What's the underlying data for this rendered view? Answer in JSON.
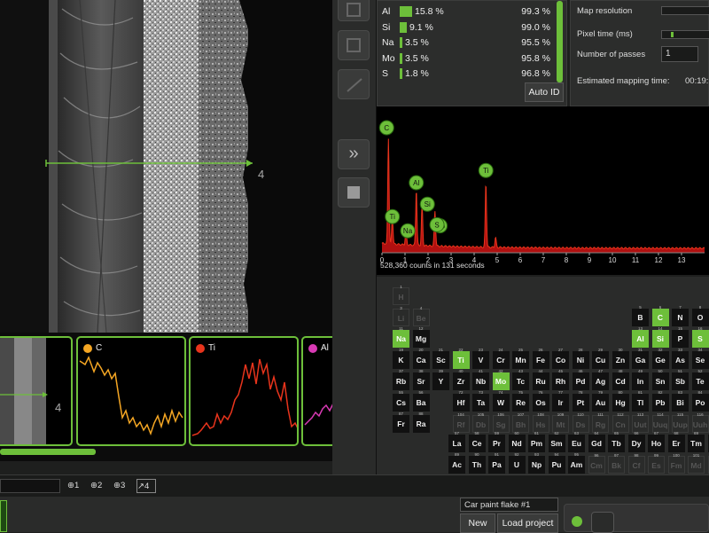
{
  "sem": {
    "line_label": "4"
  },
  "strip": {
    "thumb_label": "4",
    "channels": [
      {
        "name": "C",
        "color": "#f5a623"
      },
      {
        "name": "Ti",
        "color": "#e8341c"
      },
      {
        "name": "Al",
        "color": "#d83ab4"
      }
    ],
    "progress": 1.0
  },
  "elements": [
    {
      "sym": "Al",
      "pct": "15.8 %",
      "frac": 0.158,
      "conf": "99.3 %"
    },
    {
      "sym": "Si",
      "pct": "9.1 %",
      "frac": 0.091,
      "conf": "99.0 %"
    },
    {
      "sym": "Na",
      "pct": "3.5 %",
      "frac": 0.035,
      "conf": "95.5 %"
    },
    {
      "sym": "Mo",
      "pct": "3.5 %",
      "frac": 0.035,
      "conf": "95.8 %"
    },
    {
      "sym": "S",
      "pct": "1.8 %",
      "frac": 0.018,
      "conf": "96.8 %"
    }
  ],
  "auto_id_label": "Auto ID",
  "map_settings": {
    "resolution_label": "Map resolution",
    "pixel_time_label": "Pixel time (ms)",
    "passes_label": "Number of passes",
    "passes_value": "1",
    "est_time_label": "Estimated mapping time:",
    "est_time_value": "00:19:"
  },
  "chart_data": {
    "type": "line",
    "caption": "528,360 counts in 131 seconds",
    "xlim": [
      0,
      14
    ],
    "xticks": [
      "0",
      "1",
      "2",
      "3",
      "4",
      "5",
      "6",
      "7",
      "8",
      "9",
      "10",
      "11",
      "12",
      "13"
    ],
    "peaks": [
      {
        "label": "C",
        "x": 0.28,
        "y": 0.85
      },
      {
        "label": "Ti",
        "x": 0.45,
        "y": 0.22
      },
      {
        "label": "Na",
        "x": 1.04,
        "y": 0.12
      },
      {
        "label": "Al",
        "x": 1.49,
        "y": 0.45
      },
      {
        "label": "Si",
        "x": 1.74,
        "y": 0.32
      },
      {
        "label": "Mo",
        "x": 2.29,
        "y": 0.16
      },
      {
        "label": "S",
        "x": 2.31,
        "y": 0.14
      },
      {
        "label": "Ti",
        "x": 4.51,
        "y": 0.52
      },
      {
        "label": "Ti",
        "x": 4.93,
        "y": 0.08
      }
    ]
  },
  "periodic": {
    "rows": [
      [
        [
          "1",
          "H",
          1,
          "dim"
        ]
      ],
      [
        [
          "3",
          "Li",
          1,
          "dim"
        ],
        [
          "4",
          "Be",
          2,
          "dim"
        ],
        [
          "5",
          "B",
          13,
          ""
        ],
        [
          "6",
          "C",
          14,
          "sel"
        ],
        [
          "7",
          "N",
          15,
          ""
        ],
        [
          "8",
          "O",
          16,
          ""
        ]
      ],
      [
        [
          "11",
          "Na",
          1,
          "sel"
        ],
        [
          "12",
          "Mg",
          2,
          ""
        ],
        [
          "13",
          "Al",
          13,
          "sel"
        ],
        [
          "14",
          "Si",
          14,
          "sel"
        ],
        [
          "15",
          "P",
          15,
          ""
        ],
        [
          "16",
          "S",
          16,
          "sel"
        ]
      ],
      [
        [
          "19",
          "K",
          1,
          ""
        ],
        [
          "20",
          "Ca",
          2,
          ""
        ],
        [
          "21",
          "Sc",
          3,
          ""
        ],
        [
          "22",
          "Ti",
          4,
          "sel"
        ],
        [
          "23",
          "V",
          5,
          ""
        ],
        [
          "24",
          "Cr",
          6,
          ""
        ],
        [
          "25",
          "Mn",
          7,
          ""
        ],
        [
          "26",
          "Fe",
          8,
          ""
        ],
        [
          "27",
          "Co",
          9,
          ""
        ],
        [
          "28",
          "Ni",
          10,
          ""
        ],
        [
          "29",
          "Cu",
          11,
          ""
        ],
        [
          "30",
          "Zn",
          12,
          ""
        ],
        [
          "31",
          "Ga",
          13,
          ""
        ],
        [
          "32",
          "Ge",
          14,
          ""
        ],
        [
          "33",
          "As",
          15,
          ""
        ],
        [
          "34",
          "Se",
          16,
          ""
        ]
      ],
      [
        [
          "37",
          "Rb",
          1,
          ""
        ],
        [
          "38",
          "Sr",
          2,
          ""
        ],
        [
          "39",
          "Y",
          3,
          ""
        ],
        [
          "40",
          "Zr",
          4,
          ""
        ],
        [
          "41",
          "Nb",
          5,
          ""
        ],
        [
          "42",
          "Mo",
          6,
          "sel"
        ],
        [
          "43",
          "Tc",
          7,
          ""
        ],
        [
          "44",
          "Ru",
          8,
          ""
        ],
        [
          "45",
          "Rh",
          9,
          ""
        ],
        [
          "46",
          "Pd",
          10,
          ""
        ],
        [
          "47",
          "Ag",
          11,
          ""
        ],
        [
          "48",
          "Cd",
          12,
          ""
        ],
        [
          "49",
          "In",
          13,
          ""
        ],
        [
          "50",
          "Sn",
          14,
          ""
        ],
        [
          "51",
          "Sb",
          15,
          ""
        ],
        [
          "52",
          "Te",
          16,
          ""
        ]
      ],
      [
        [
          "55",
          "Cs",
          1,
          ""
        ],
        [
          "56",
          "Ba",
          2,
          ""
        ],
        [
          "72",
          "Hf",
          4,
          ""
        ],
        [
          "73",
          "Ta",
          5,
          ""
        ],
        [
          "74",
          "W",
          6,
          ""
        ],
        [
          "75",
          "Re",
          7,
          ""
        ],
        [
          "76",
          "Os",
          8,
          ""
        ],
        [
          "77",
          "Ir",
          9,
          ""
        ],
        [
          "78",
          "Pt",
          10,
          ""
        ],
        [
          "79",
          "Au",
          11,
          ""
        ],
        [
          "80",
          "Hg",
          12,
          ""
        ],
        [
          "81",
          "Tl",
          13,
          ""
        ],
        [
          "82",
          "Pb",
          14,
          ""
        ],
        [
          "83",
          "Bi",
          15,
          ""
        ],
        [
          "84",
          "Po",
          16,
          ""
        ]
      ],
      [
        [
          "87",
          "Fr",
          1,
          ""
        ],
        [
          "88",
          "Ra",
          2,
          ""
        ],
        [
          "104",
          "Rf",
          4,
          "dim"
        ],
        [
          "105",
          "Db",
          5,
          "dim"
        ],
        [
          "106",
          "Sg",
          6,
          "dim"
        ],
        [
          "107",
          "Bh",
          7,
          "dim"
        ],
        [
          "108",
          "Hs",
          8,
          "dim"
        ],
        [
          "109",
          "Mt",
          9,
          "dim"
        ],
        [
          "110",
          "Ds",
          10,
          "dim"
        ],
        [
          "111",
          "Rg",
          11,
          "dim"
        ],
        [
          "112",
          "Cn",
          12,
          "dim"
        ],
        [
          "113",
          "Uut",
          13,
          "dim"
        ],
        [
          "114",
          "Uuq",
          14,
          "dim"
        ],
        [
          "115",
          "Uup",
          15,
          "dim"
        ],
        [
          "116",
          "Uuh",
          16,
          "dim"
        ]
      ]
    ],
    "lanthanides": [
      [
        "57",
        "La"
      ],
      [
        "58",
        "Ce"
      ],
      [
        "59",
        "Pr"
      ],
      [
        "60",
        "Nd"
      ],
      [
        "61",
        "Pm"
      ],
      [
        "62",
        "Sm"
      ],
      [
        "63",
        "Eu"
      ],
      [
        "64",
        "Gd"
      ],
      [
        "65",
        "Tb"
      ],
      [
        "66",
        "Dy"
      ],
      [
        "67",
        "Ho"
      ],
      [
        "68",
        "Er"
      ],
      [
        "69",
        "Tm"
      ],
      [
        "70",
        "Yb"
      ]
    ],
    "actinides": [
      [
        "89",
        "Ac"
      ],
      [
        "90",
        "Th"
      ],
      [
        "91",
        "Pa"
      ],
      [
        "92",
        "U"
      ],
      [
        "93",
        "Np"
      ],
      [
        "94",
        "Pu"
      ],
      [
        "95",
        "Am"
      ],
      [
        "96",
        "Cm",
        "dim"
      ],
      [
        "97",
        "Bk",
        "dim"
      ],
      [
        "98",
        "Cf",
        "dim"
      ],
      [
        "99",
        "Es",
        "dim"
      ],
      [
        "100",
        "Fm",
        "dim"
      ],
      [
        "101",
        "Md",
        "dim"
      ],
      [
        "102",
        "No",
        "dim"
      ]
    ]
  },
  "toolbar": {
    "tools": [
      "1",
      "2",
      "3",
      "4"
    ]
  },
  "bottom": {
    "project_name": "Car paint flake #1",
    "new_label": "New",
    "load_label": "Load project"
  }
}
